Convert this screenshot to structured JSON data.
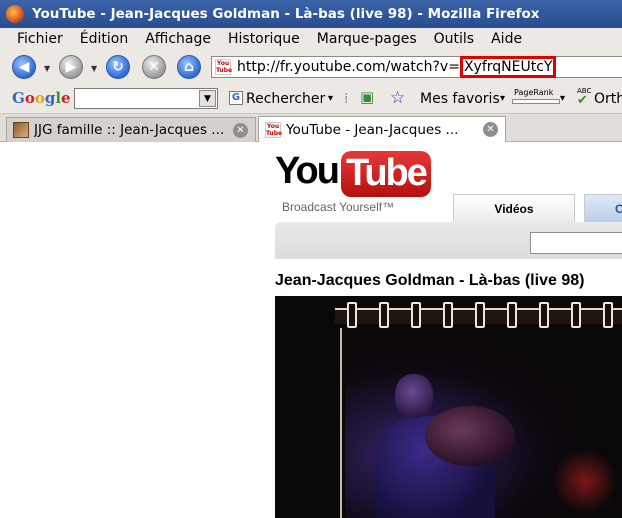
{
  "window": {
    "title": "YouTube - Jean-Jacques Goldman - Là-bas (live 98) - Mozilla Firefox"
  },
  "menubar": {
    "items": [
      "Fichier",
      "Édition",
      "Affichage",
      "Historique",
      "Marque-pages",
      "Outils",
      "Aide"
    ]
  },
  "navbar": {
    "url_prefix": "http://fr.youtube.com/watch?v=",
    "url_highlight": "XyfrqNEUtcY",
    "highlight_color": "#e00000"
  },
  "google_toolbar": {
    "logo": "Google",
    "search_value": "",
    "search_label": "Rechercher",
    "favorites_label": "Mes favoris",
    "pagerank_label": "PageRank",
    "spellcheck_label": "Orth",
    "abc_label": "ABC"
  },
  "tabs": [
    {
      "label": "JJG famille :: Jean-Jacques ...",
      "active": false
    },
    {
      "label": "YouTube - Jean-Jacques ...",
      "active": true
    }
  ],
  "youtube": {
    "logo_you": "You",
    "logo_tube": "Tube",
    "tagline": "Broadcast Yourself™",
    "tab_videos": "Vidéos",
    "tab_second_partial": "C",
    "video_title": "Jean-Jacques Goldman - Là-bas (live 98)",
    "brand_color": "#cc181e"
  }
}
